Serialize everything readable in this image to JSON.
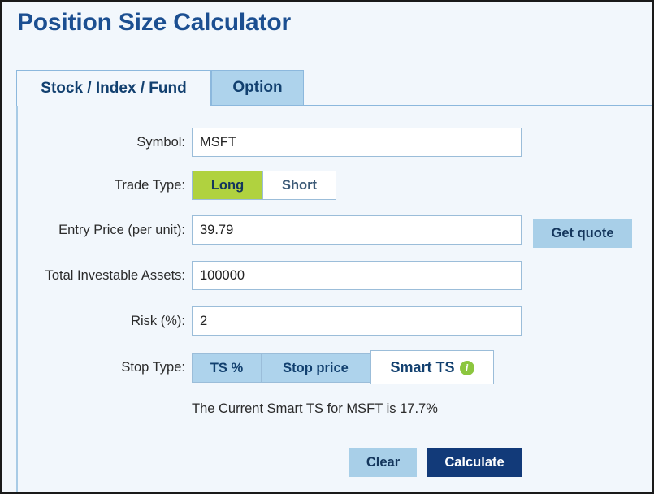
{
  "page": {
    "title": "Position Size Calculator"
  },
  "tabs": [
    {
      "label": "Stock / Index / Fund",
      "active": true
    },
    {
      "label": "Option",
      "active": false
    }
  ],
  "form": {
    "symbol": {
      "label": "Symbol:",
      "value": "MSFT",
      "placeholder": ""
    },
    "trade_type": {
      "label": "Trade Type:",
      "options": [
        {
          "label": "Long",
          "selected": true
        },
        {
          "label": "Short",
          "selected": false
        }
      ]
    },
    "entry_price": {
      "label": "Entry Price (per unit):",
      "value": "39.79",
      "placeholder": ""
    },
    "get_quote_label": "Get quote",
    "total_assets": {
      "label": "Total Investable Assets:",
      "value": "100000",
      "placeholder": ""
    },
    "risk": {
      "label": "Risk (%):",
      "value": "2",
      "placeholder": ""
    },
    "stop_type": {
      "label": "Stop Type:",
      "options": [
        {
          "label": "TS %",
          "active": false
        },
        {
          "label": "Stop price",
          "active": false
        },
        {
          "label": "Smart TS",
          "active": true,
          "icon": "info-icon",
          "icon_glyph": "i"
        }
      ]
    },
    "smart_ts_note": "The Current Smart TS for MSFT is 17.7%"
  },
  "actions": {
    "clear_label": "Clear",
    "calculate_label": "Calculate"
  },
  "colors": {
    "title_blue": "#1c4f91",
    "tab_inactive_blue": "#aed3ec",
    "panel_bg": "#f2f7fc",
    "long_green": "#b0d23f",
    "info_green": "#8cc63e",
    "calculate_navy": "#123a79",
    "clear_blue": "#a8cfe8",
    "border_blue": "#9bbdd9"
  }
}
